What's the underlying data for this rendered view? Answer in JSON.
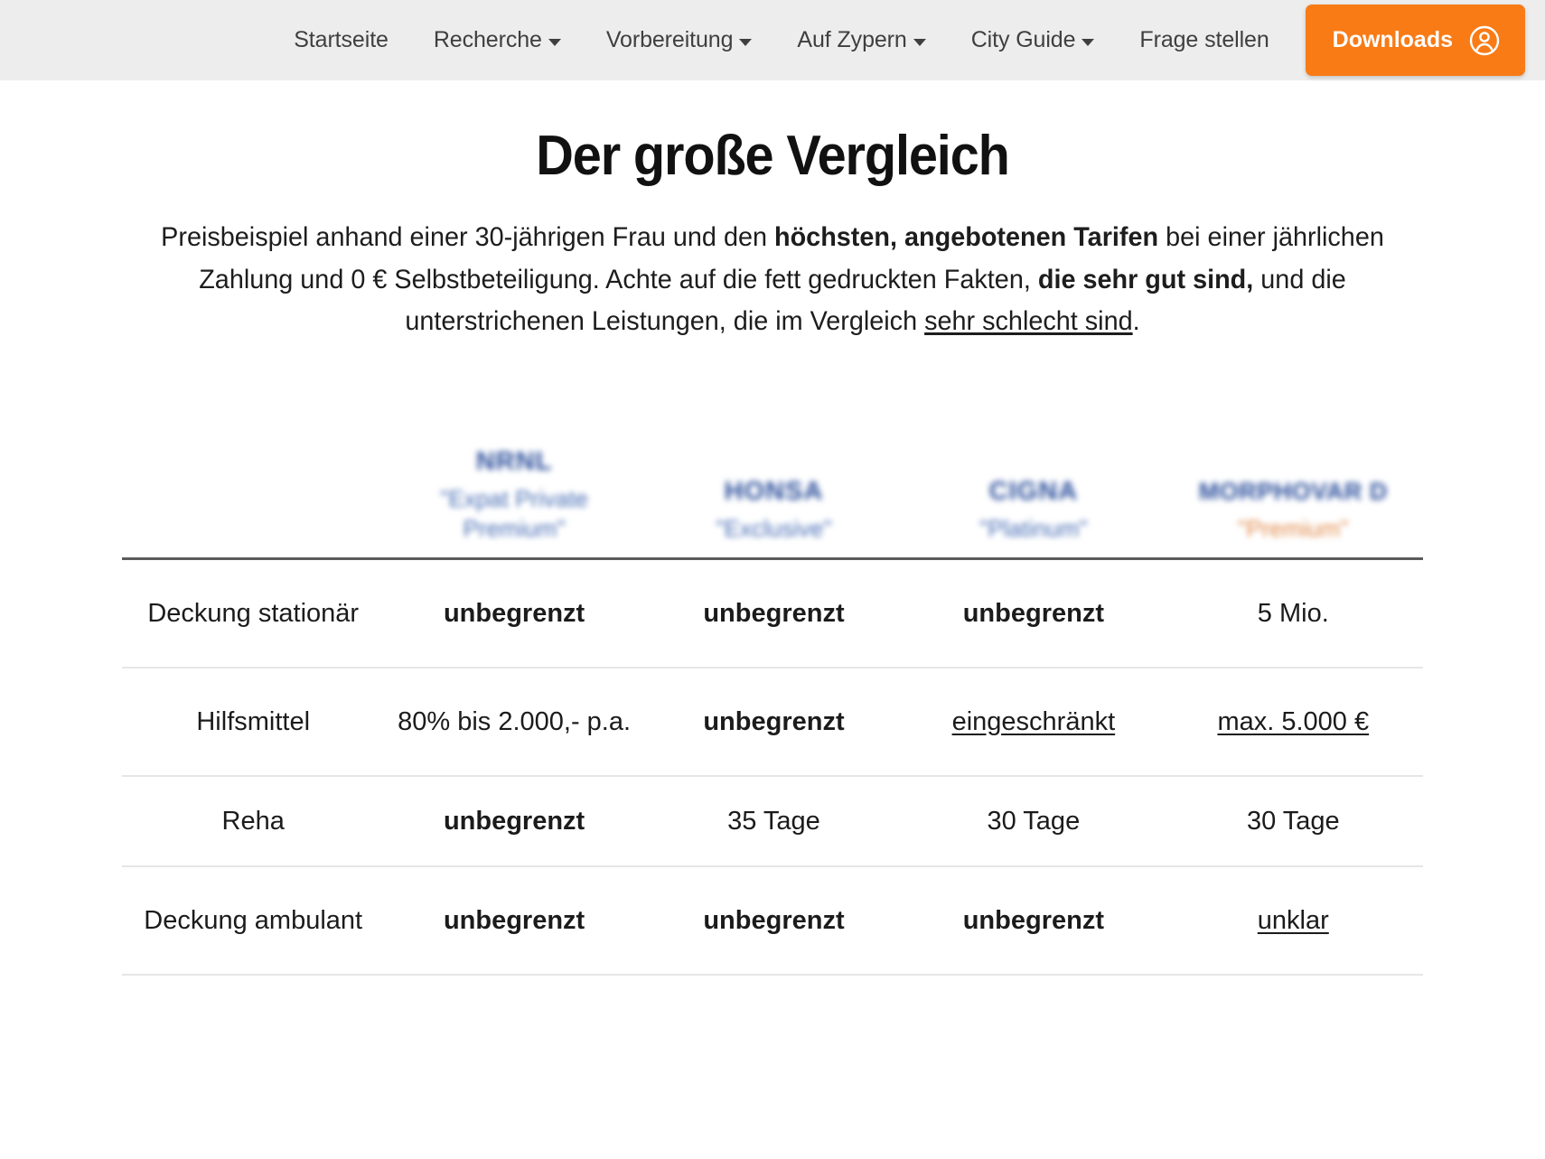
{
  "nav": {
    "items": [
      {
        "label": "Startseite",
        "has_dropdown": false
      },
      {
        "label": "Recherche",
        "has_dropdown": true
      },
      {
        "label": "Vorbereitung",
        "has_dropdown": true
      },
      {
        "label": "Auf Zypern",
        "has_dropdown": true
      },
      {
        "label": "City Guide",
        "has_dropdown": true
      },
      {
        "label": "Frage stellen",
        "has_dropdown": false
      }
    ],
    "downloads_label": "Downloads",
    "downloads_icon": "user-circle-icon",
    "accent_color": "#f97b16",
    "bar_color": "#ededed"
  },
  "page": {
    "title": "Der große Vergleich",
    "intro": {
      "part1": "Preisbeispiel anhand einer 30-jährigen Frau und den ",
      "bold1": "höchsten, angebotenen Tarifen",
      "part2": " bei einer jährlichen Zahlung und 0 € Selbstbeteiligung. Achte auf die fett gedruckten Fakten, ",
      "bold2": "die sehr gut sind,",
      "part3": " und die unterstrichenen Leistungen, die im Vergleich ",
      "underline1": "sehr schlecht sind",
      "part4": "."
    }
  },
  "table": {
    "label_column_header": "",
    "columns": [
      {
        "logo": "NRNL",
        "tariff": "\"Expat Private Premium\"",
        "tariff_color": "#4a6fb5"
      },
      {
        "logo": "HONSA",
        "tariff": "\"Exclusive\"",
        "tariff_color": "#4a6fb5"
      },
      {
        "logo": "CIGNA",
        "tariff": "\"Platinum\"",
        "tariff_color": "#4a6fb5"
      },
      {
        "logo": "MORPHOVAR D",
        "tariff": "\"Premium\"",
        "tariff_color": "#e08a4a"
      }
    ],
    "rows": [
      {
        "label": "Deckung stationär",
        "cells": [
          {
            "text": "unbegrenzt",
            "bold": true,
            "underline": false
          },
          {
            "text": "unbegrenzt",
            "bold": true,
            "underline": false
          },
          {
            "text": "unbegrenzt",
            "bold": true,
            "underline": false
          },
          {
            "text": "5 Mio.",
            "bold": false,
            "underline": false
          }
        ]
      },
      {
        "label": "Hilfsmittel",
        "cells": [
          {
            "text": "80% bis 2.000,- p.a.",
            "bold": false,
            "underline": false
          },
          {
            "text": "unbegrenzt",
            "bold": true,
            "underline": false
          },
          {
            "text": "eingeschränkt",
            "bold": false,
            "underline": true
          },
          {
            "text": "max. 5.000 €",
            "bold": false,
            "underline": true
          }
        ]
      },
      {
        "label": "Reha",
        "cells": [
          {
            "text": "unbegrenzt",
            "bold": true,
            "underline": false
          },
          {
            "text": "35 Tage",
            "bold": false,
            "underline": false
          },
          {
            "text": "30 Tage",
            "bold": false,
            "underline": false
          },
          {
            "text": "30 Tage",
            "bold": false,
            "underline": false
          }
        ]
      },
      {
        "label": "Deckung ambulant",
        "cells": [
          {
            "text": "unbegrenzt",
            "bold": true,
            "underline": false
          },
          {
            "text": "unbegrenzt",
            "bold": true,
            "underline": false
          },
          {
            "text": "unbegrenzt",
            "bold": true,
            "underline": false
          },
          {
            "text": "unklar",
            "bold": false,
            "underline": true
          }
        ]
      }
    ]
  }
}
